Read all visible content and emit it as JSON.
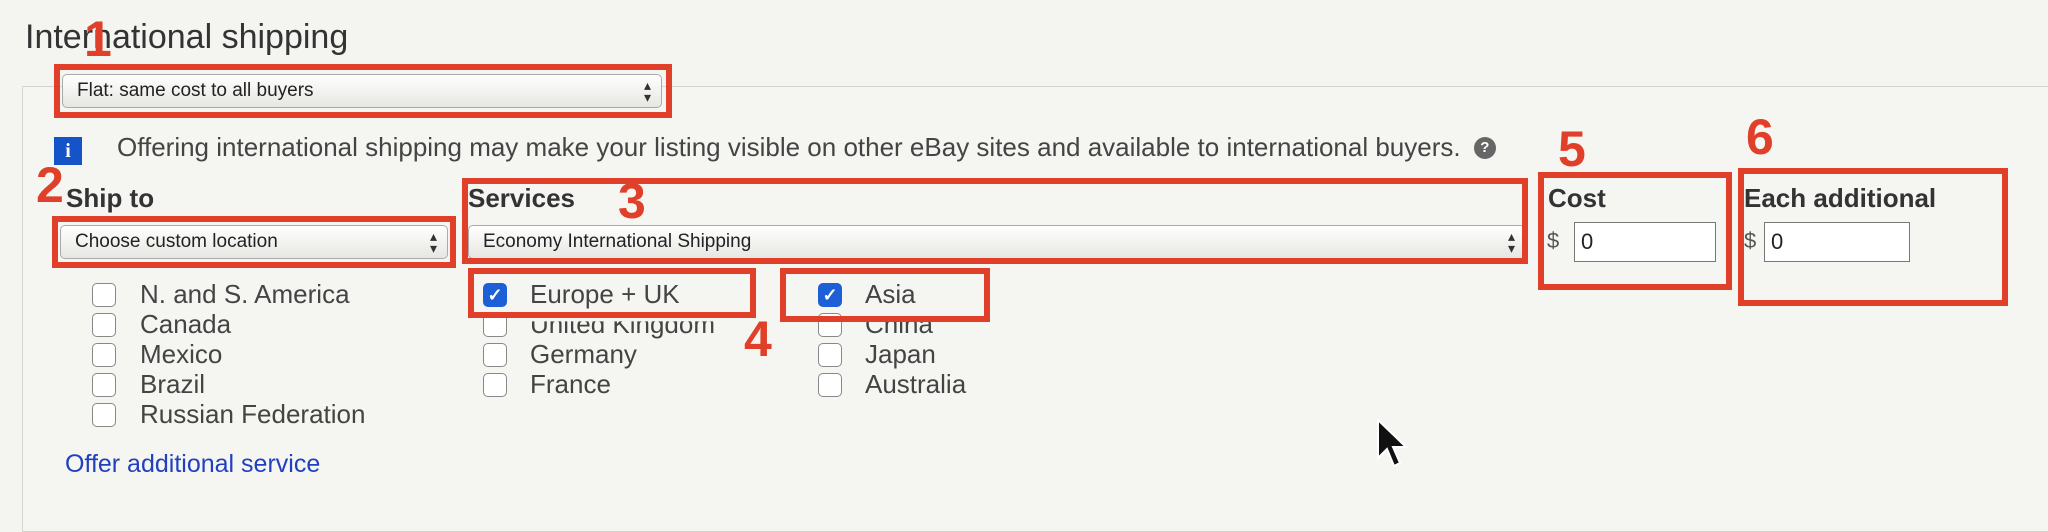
{
  "section_title": "International shipping",
  "rate_type_select": "Flat: same cost to all buyers",
  "notice": "Offering international shipping may make your listing visible on other eBay sites and available to international buyers.",
  "ship_to": {
    "label": "Ship to",
    "select": "Choose custom location"
  },
  "services": {
    "label": "Services",
    "select": "Economy International Shipping"
  },
  "cost": {
    "label": "Cost",
    "currency": "$",
    "value": "0"
  },
  "each_additional": {
    "label": "Each additional",
    "currency": "$",
    "value": "0"
  },
  "regions": [
    {
      "label": "N. and S. America",
      "checked": false,
      "countries": [
        "Canada",
        "Mexico",
        "Brazil",
        "Russian Federation"
      ]
    },
    {
      "label": "Europe + UK",
      "checked": true,
      "countries": [
        "United Kingdom",
        "Germany",
        "France"
      ]
    },
    {
      "label": "Asia",
      "checked": true,
      "countries": [
        "China",
        "Japan",
        "Australia"
      ]
    }
  ],
  "offer_additional_link": "Offer additional service",
  "annotation_numbers": [
    "1",
    "2",
    "3",
    "4",
    "5",
    "6"
  ],
  "accent_color": "#e0402a",
  "icons": {
    "info": "info-icon",
    "help": "help-icon",
    "cursor": "mouse-pointer-icon",
    "checkbox": "checkbox-icon",
    "select_arrows": "updown-arrows-icon"
  }
}
